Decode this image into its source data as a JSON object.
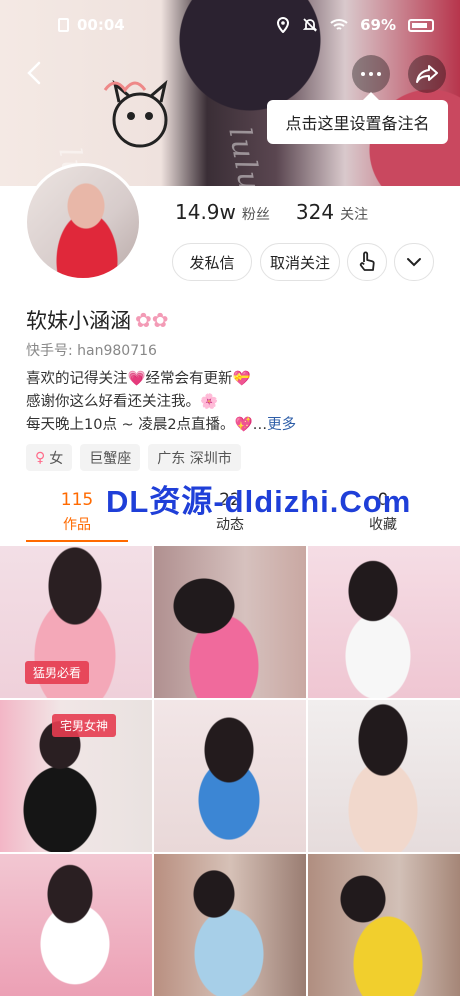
{
  "status_bar": {
    "time": "00:04",
    "battery": "69%"
  },
  "cover": {
    "watermark": "lululu.la",
    "tooltip": "点击这里设置备注名"
  },
  "profile": {
    "fans_count": "14.9w",
    "fans_label": "粉丝",
    "following_count": "324",
    "following_label": "关注",
    "message_button": "发私信",
    "unfollow_button": "取消关注",
    "nickname": "软妹小涵涵",
    "kwai_id": "快手号: han980716",
    "bio": [
      "喜欢的记得关注💗经常会有更新💝",
      "感谢你这么好看还关注我。🌸",
      "每天晚上10点 ~ 凌晨2点直播。💖…"
    ],
    "bio_more": "更多",
    "tags": [
      "女",
      "巨蟹座",
      "广东 深圳市"
    ]
  },
  "tabs": [
    {
      "count": "115",
      "label": "作品",
      "active": true
    },
    {
      "count": "22",
      "label": "动态",
      "active": false
    },
    {
      "count": "0",
      "label": "收藏",
      "active": false
    }
  ],
  "overlay_text": "DL资源-dldizhi.Com",
  "grid": {
    "badges": {
      "post_1": "猛男必看",
      "post_4": "宅男女神"
    }
  },
  "colors": {
    "accent": "#ff6a00",
    "link": "#2e5ea8",
    "overlay": "#1f3fd8"
  }
}
